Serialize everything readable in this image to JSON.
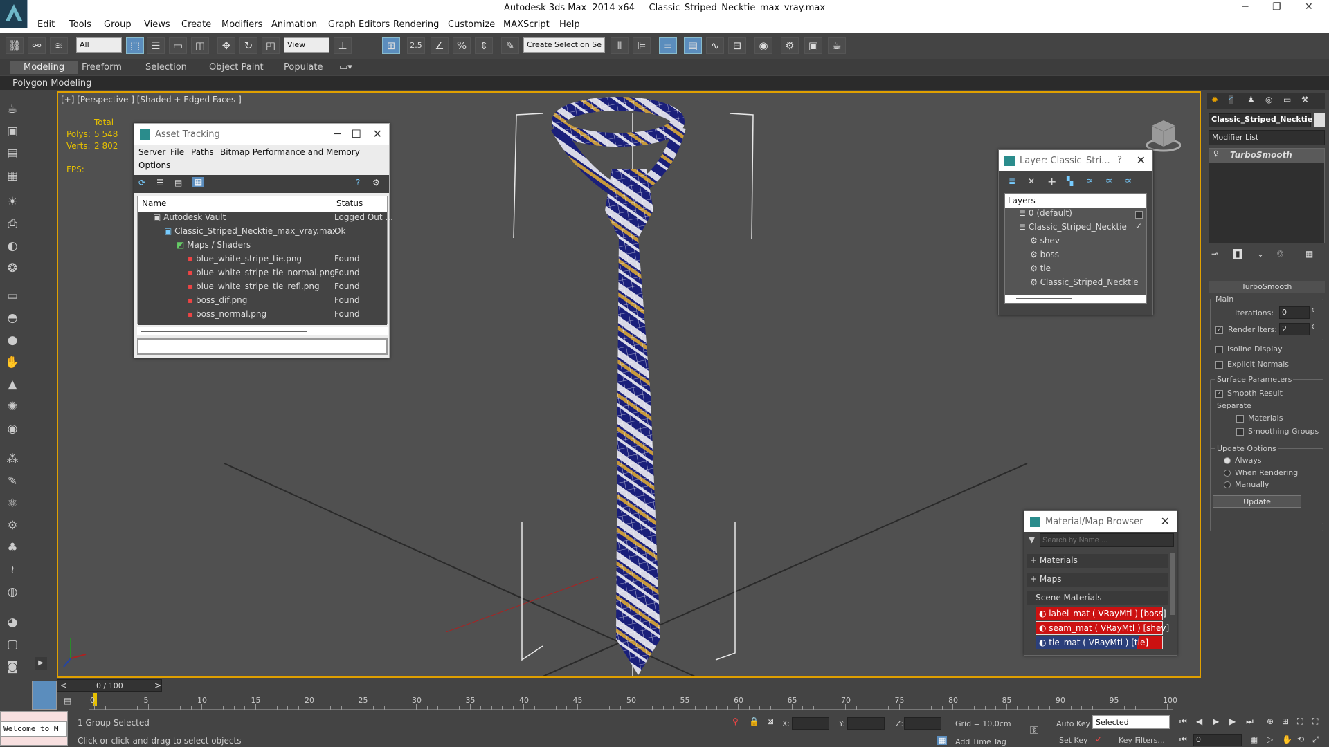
{
  "window": {
    "title": "Autodesk 3ds Max  2014 x64     Classic_Striped_Necktie_max_vray.max",
    "min": "─",
    "restore": "❐",
    "close": "✕"
  },
  "menu": [
    "Edit",
    "Tools",
    "Group",
    "Views",
    "Create",
    "Modifiers",
    "Animation",
    "Graph Editors",
    "Rendering",
    "Customize",
    "MAXScript",
    "Help"
  ],
  "toolbar": {
    "filter": "All",
    "refcoord": "View",
    "snap_angle": "2.5",
    "selection_set": "Create Selection Se"
  },
  "ribbon": {
    "tabs": [
      "Modeling",
      "Freeform",
      "Selection",
      "Object Paint",
      "Populate"
    ],
    "active": "Modeling",
    "subpanel": "Polygon Modeling"
  },
  "viewport": {
    "label": "[+] [Perspective ] [Shaded + Edged Faces ]",
    "stats": {
      "total": "Total",
      "polys_label": "Polys:",
      "polys": "5 548",
      "verts_label": "Verts:",
      "verts": "2 802",
      "fps_label": "FPS:"
    }
  },
  "asset_tracking": {
    "title": "Asset Tracking",
    "menu": [
      "Server",
      "File",
      "Paths",
      "Bitmap Performance and Memory",
      "Options"
    ],
    "columns": [
      "Name",
      "Status"
    ],
    "rows": [
      {
        "name": "Autodesk Vault",
        "status": "Logged Out ..."
      },
      {
        "name": "Classic_Striped_Necktie_max_vray.max",
        "status": "Ok"
      },
      {
        "name": "Maps / Shaders",
        "status": ""
      },
      {
        "name": "blue_white_stripe_tie.png",
        "status": "Found"
      },
      {
        "name": "blue_white_stripe_tie_normal.png",
        "status": "Found"
      },
      {
        "name": "blue_white_stripe_tie_refl.png",
        "status": "Found"
      },
      {
        "name": "boss_dif.png",
        "status": "Found"
      },
      {
        "name": "boss_normal.png",
        "status": "Found"
      }
    ]
  },
  "layer_window": {
    "title": "Layer: Classic_Stri...",
    "help": "?",
    "header": "Layers",
    "rows": [
      "0 (default)",
      "Classic_Striped_Necktie",
      "shev",
      "boss",
      "tie",
      "Classic_Striped_Necktie"
    ]
  },
  "material_browser": {
    "title": "Material/Map Browser",
    "search_placeholder": "Search by Name ...",
    "groups": [
      "+ Materials",
      "+ Maps",
      "- Scene Materials"
    ],
    "materials": [
      "label_mat  ( VRayMtl )  [boss]",
      "seam_mat  ( VRayMtl )  [shev]",
      "tie_mat  ( VRayMtl )  [tie]"
    ],
    "swatch_color": "#cc1111"
  },
  "command_panel": {
    "object_name": "Classic_Striped_Necktie",
    "modifier_list": "Modifier List",
    "stack_item": "TurboSmooth",
    "rollout_title": "TurboSmooth",
    "main_label": "Main",
    "iterations_label": "Iterations:",
    "iterations": "0",
    "render_iters_label": "Render Iters:",
    "render_iters": "2",
    "isoline": "Isoline Display",
    "explicit": "Explicit Normals",
    "surface_label": "Surface Parameters",
    "smooth_result": "Smooth Result",
    "separate_label": "Separate",
    "materials": "Materials",
    "smoothing_groups": "Smoothing Groups",
    "update_options_label": "Update Options",
    "always": "Always",
    "when_rendering": "When Rendering",
    "manually": "Manually",
    "update_button": "Update"
  },
  "timeline": {
    "frame": "0 / 100",
    "ticks": [
      "0",
      "5",
      "10",
      "15",
      "20",
      "25",
      "30",
      "35",
      "40",
      "45",
      "50",
      "55",
      "60",
      "65",
      "70",
      "75",
      "80",
      "85",
      "90",
      "95",
      "100"
    ],
    "prev": "<",
    "next": ">"
  },
  "status": {
    "welcome": "Welcome to M",
    "selected_text": "1 Group Selected",
    "prompt": "Click or click-and-drag to select objects",
    "x_label": "X:",
    "y_label": "Y:",
    "z_label": "Z:",
    "grid": "Grid = 10,0cm",
    "add_time_tag": "Add Time Tag",
    "auto_key": "Auto Key",
    "set_key": "Set Key",
    "selected_dd": "Selected",
    "key_filters": "Key Filters...",
    "frame_value": "0"
  },
  "colors": {
    "viewport_border": "#e0a000",
    "stats": "#e6c000",
    "accent": "#5b8dbd"
  }
}
